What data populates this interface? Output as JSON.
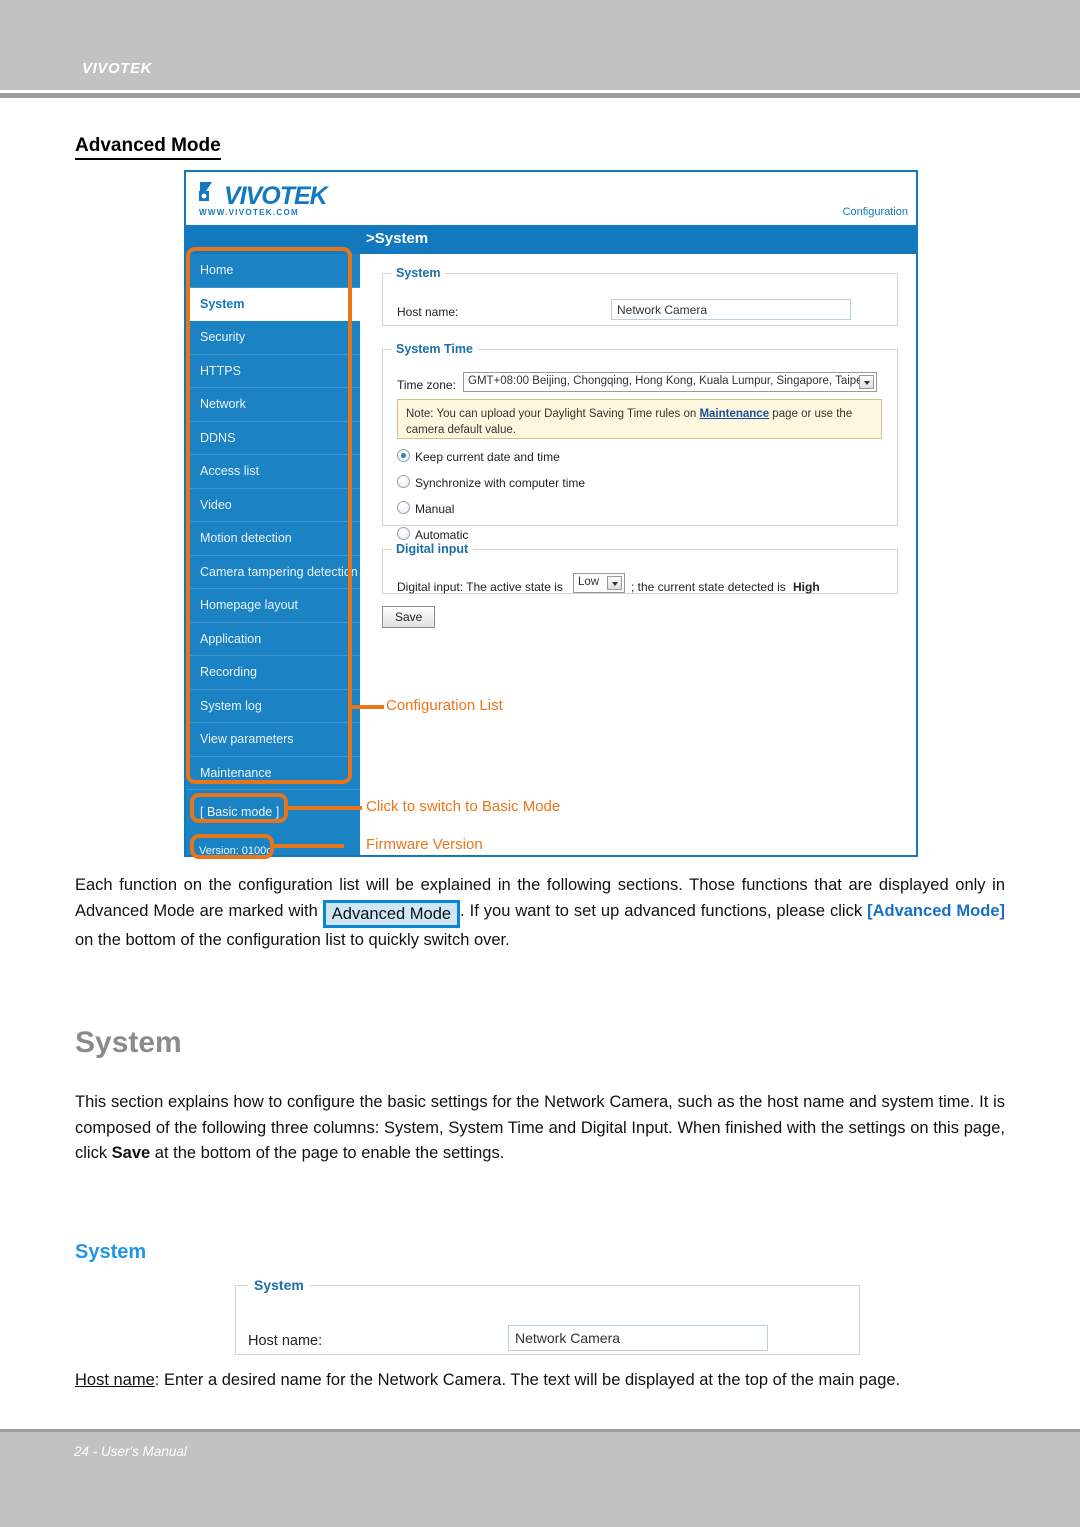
{
  "page": {
    "brand": "VIVOTEK",
    "footer": "24 - User's Manual"
  },
  "headings": {
    "advanced_mode": "Advanced Mode",
    "system_h1": "System",
    "system_h2": "System"
  },
  "paragraphs": {
    "advanced_part1": "Each function on the configuration list will be explained in the following sections. Those functions that are displayed only in Advanced Mode are marked with ",
    "advanced_badge": "Advanced Mode",
    "advanced_part2": ". If you want to set up advanced functions, please click ",
    "advanced_link": "[Advanced Mode]",
    "advanced_part3": " on the bottom of the configuration list to quickly switch over.",
    "system_part1": "This section explains how to configure the basic settings for the Network Camera, such as the host name and system time. It is composed of the following three columns: System, System Time and Digital Input. When finished with the settings on this page, click ",
    "system_bold": "Save",
    "system_part2": " at the bottom of the page to enable the settings.",
    "hostname_label": "Host name",
    "hostname_rest": ": Enter a desired name for the Network Camera. The text will be displayed at the top of the main page."
  },
  "camera_ui": {
    "logo_word": "VIVOTEK",
    "logo_url": "WWW.VIVOTEK.COM",
    "config_link": "Configuration",
    "title": ">System",
    "sidebar": {
      "items": [
        {
          "label": "Home",
          "active": false
        },
        {
          "label": "System",
          "active": true
        },
        {
          "label": "Security",
          "active": false
        },
        {
          "label": "HTTPS",
          "active": false
        },
        {
          "label": "Network",
          "active": false
        },
        {
          "label": "DDNS",
          "active": false
        },
        {
          "label": "Access list",
          "active": false
        },
        {
          "label": "Video",
          "active": false
        },
        {
          "label": "Motion detection",
          "active": false
        },
        {
          "label": "Camera tampering detection",
          "active": false
        },
        {
          "label": "Homepage layout",
          "active": false
        },
        {
          "label": "Application",
          "active": false
        },
        {
          "label": "Recording",
          "active": false
        },
        {
          "label": "System log",
          "active": false
        },
        {
          "label": "View parameters",
          "active": false
        },
        {
          "label": "Maintenance",
          "active": false
        }
      ],
      "basic_mode": "[ Basic mode ]",
      "version": "Version: 0100c"
    },
    "system_box": {
      "legend": "System",
      "host_name_label": "Host name:",
      "host_name_value": "Network Camera"
    },
    "system_time_box": {
      "legend": "System Time",
      "time_zone_label": "Time zone:",
      "time_zone_value": "GMT+08:00 Beijing, Chongqing, Hong Kong, Kuala Lumpur, Singapore, Taipei",
      "note_prefix": "Note: You can upload your Daylight Saving Time rules on ",
      "note_link": "Maintenance",
      "note_suffix": " page or use the camera default value.",
      "options": [
        {
          "label": "Keep current date and time",
          "selected": true
        },
        {
          "label": "Synchronize with computer time",
          "selected": false
        },
        {
          "label": "Manual",
          "selected": false
        },
        {
          "label": "Automatic",
          "selected": false
        }
      ]
    },
    "digital_input_box": {
      "legend": "Digital input",
      "prefix": "Digital input: The active state is",
      "state_value": "Low",
      "suffix": "; the current state detected is",
      "detected": "High"
    },
    "save_button": "Save"
  },
  "annotations": {
    "configuration_list": "Configuration List",
    "switch_basic_mode": "Click to switch to Basic Mode",
    "firmware_version": "Firmware Version"
  },
  "standalone_system_box": {
    "legend": "System",
    "host_name_label": "Host name:",
    "host_name_value": "Network Camera"
  },
  "colors": {
    "header_band": "#c2c2c2",
    "camera_blue": "#1379bf",
    "sidebar_blue": "#1b82c4",
    "annotation_orange": "#e8751a",
    "heading_gray": "#8b8b8b",
    "heading_blue": "#2196e8",
    "note_yellow": "#fdf8dd"
  }
}
